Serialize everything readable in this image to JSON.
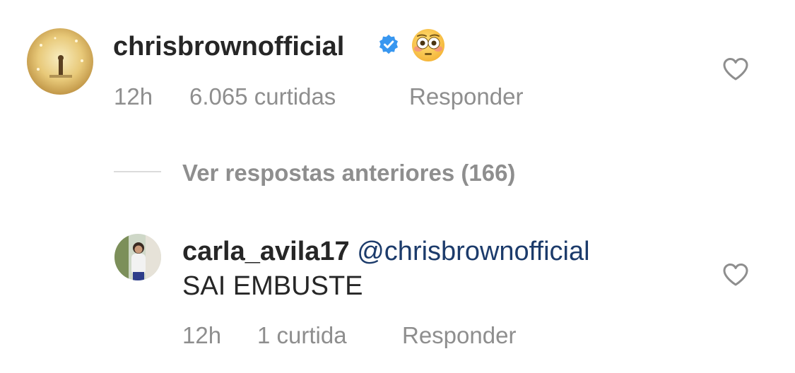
{
  "colors": {
    "text_primary": "#262626",
    "text_secondary": "#8e8e8e",
    "mention": "#1c3b6b",
    "verified": "#3897f0",
    "divider": "#dbdbdb"
  },
  "comments": [
    {
      "username": "chrisbrownofficial",
      "verified": true,
      "emoji_icon": "flushed-face-emoji",
      "time": "12h",
      "likes": "6.065 curtidas",
      "reply_label": "Responder"
    },
    {
      "username": "carla_avila17",
      "mention": "@chrisbrownofficial",
      "text": "SAI EMBUSTE",
      "time": "12h",
      "likes": "1 curtida",
      "reply_label": "Responder"
    }
  ],
  "view_replies_label": "Ver respostas anteriores (166)",
  "icons": {
    "like": "heart-outline-icon",
    "verified": "verified-badge-icon"
  }
}
